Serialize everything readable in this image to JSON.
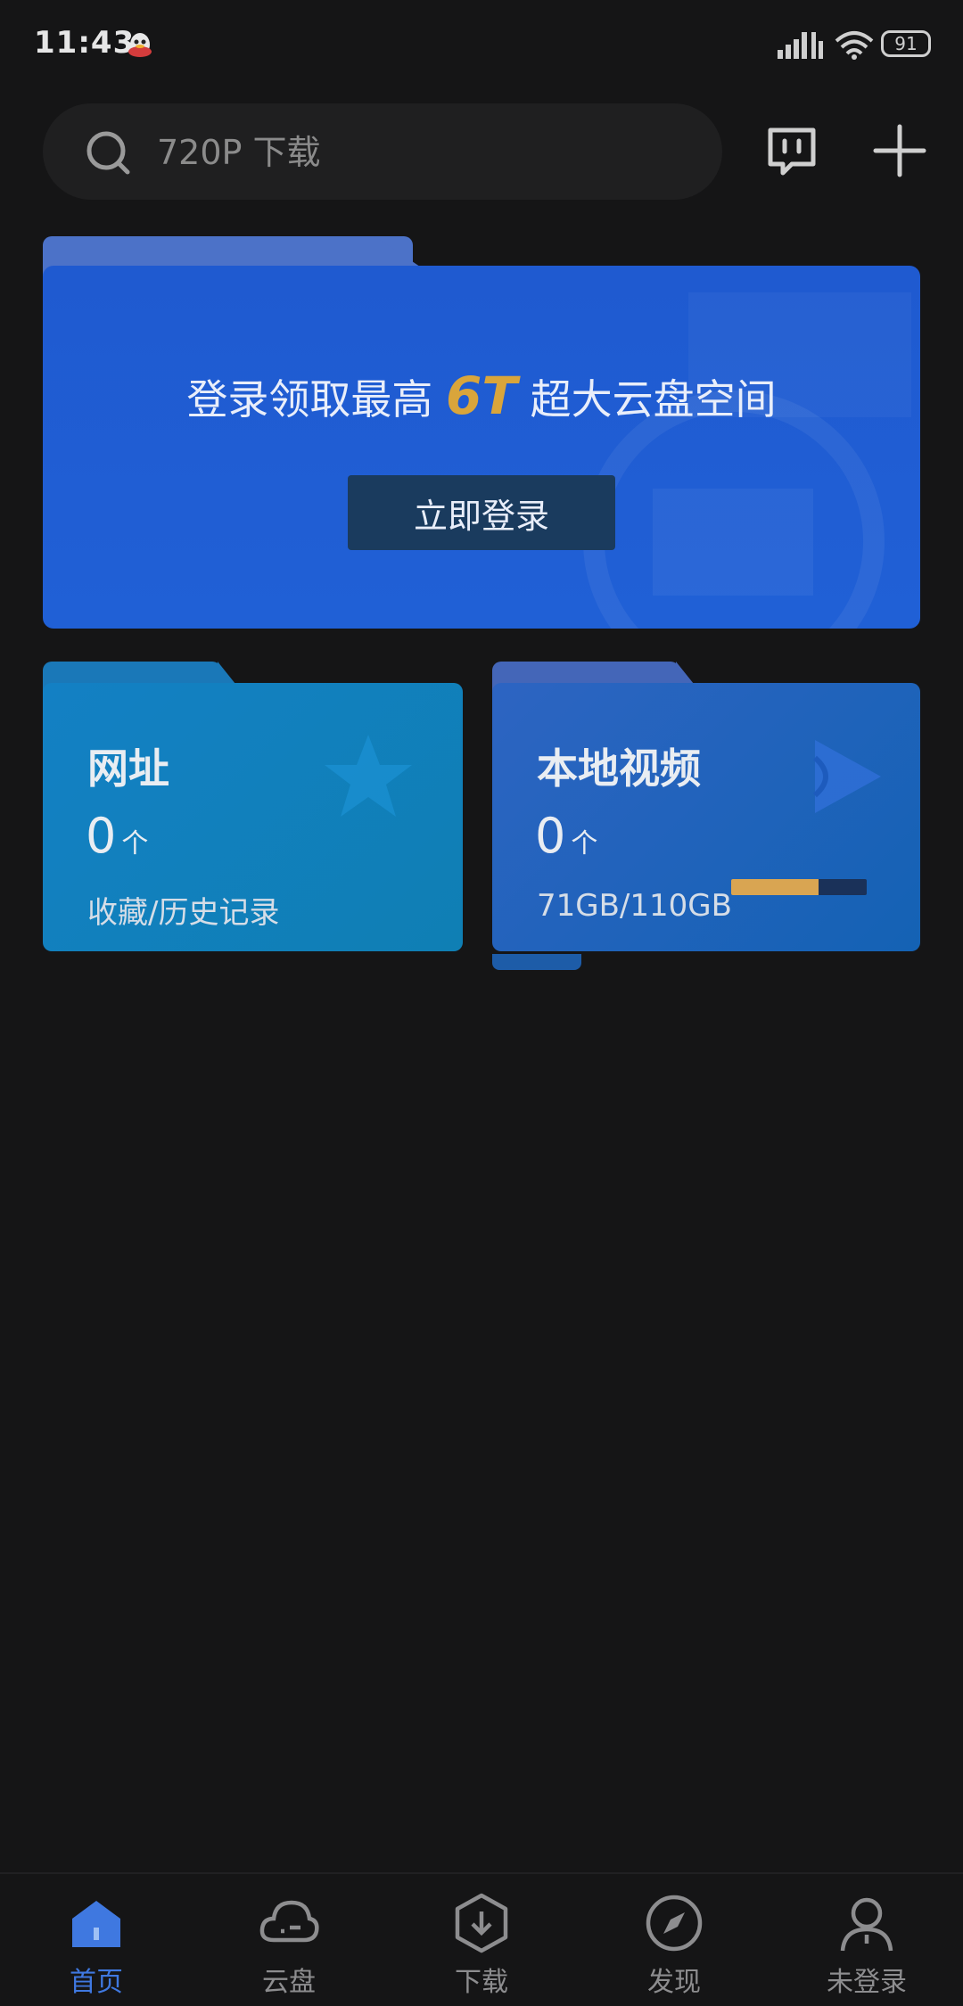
{
  "status_bar": {
    "time": "11:43",
    "battery": "91",
    "icons": [
      "qq-icon",
      "signal-icon",
      "wifi-icon",
      "battery-icon"
    ]
  },
  "search": {
    "placeholder": "720P 下载",
    "icon": "search-icon"
  },
  "header_actions": {
    "message_icon": "message-icon",
    "add_icon": "plus-icon"
  },
  "banner": {
    "title_before": "登录领取最高",
    "title_highlight": "6T",
    "title_after": "超大云盘空间",
    "button_label": "立即登录",
    "highlight_color": "#d9a53b"
  },
  "cards": {
    "bookmarks": {
      "title": "网址",
      "count": "0",
      "unit": "个",
      "subtitle": "收藏/历史记录",
      "icon": "star-icon"
    },
    "local_video": {
      "title": "本地视频",
      "count": "0",
      "unit": "个",
      "storage_text": "71GB/110GB",
      "storage_used_fraction": 0.645,
      "icon": "play-icon"
    }
  },
  "bottom_nav": {
    "items": [
      {
        "label": "首页",
        "icon": "home-icon",
        "active": true
      },
      {
        "label": "云盘",
        "icon": "cloud-icon",
        "active": false
      },
      {
        "label": "下载",
        "icon": "download-icon",
        "active": false
      },
      {
        "label": "发现",
        "icon": "compass-icon",
        "active": false
      },
      {
        "label": "未登录",
        "icon": "user-icon",
        "active": false
      }
    ],
    "active_color": "#3f78e0"
  }
}
